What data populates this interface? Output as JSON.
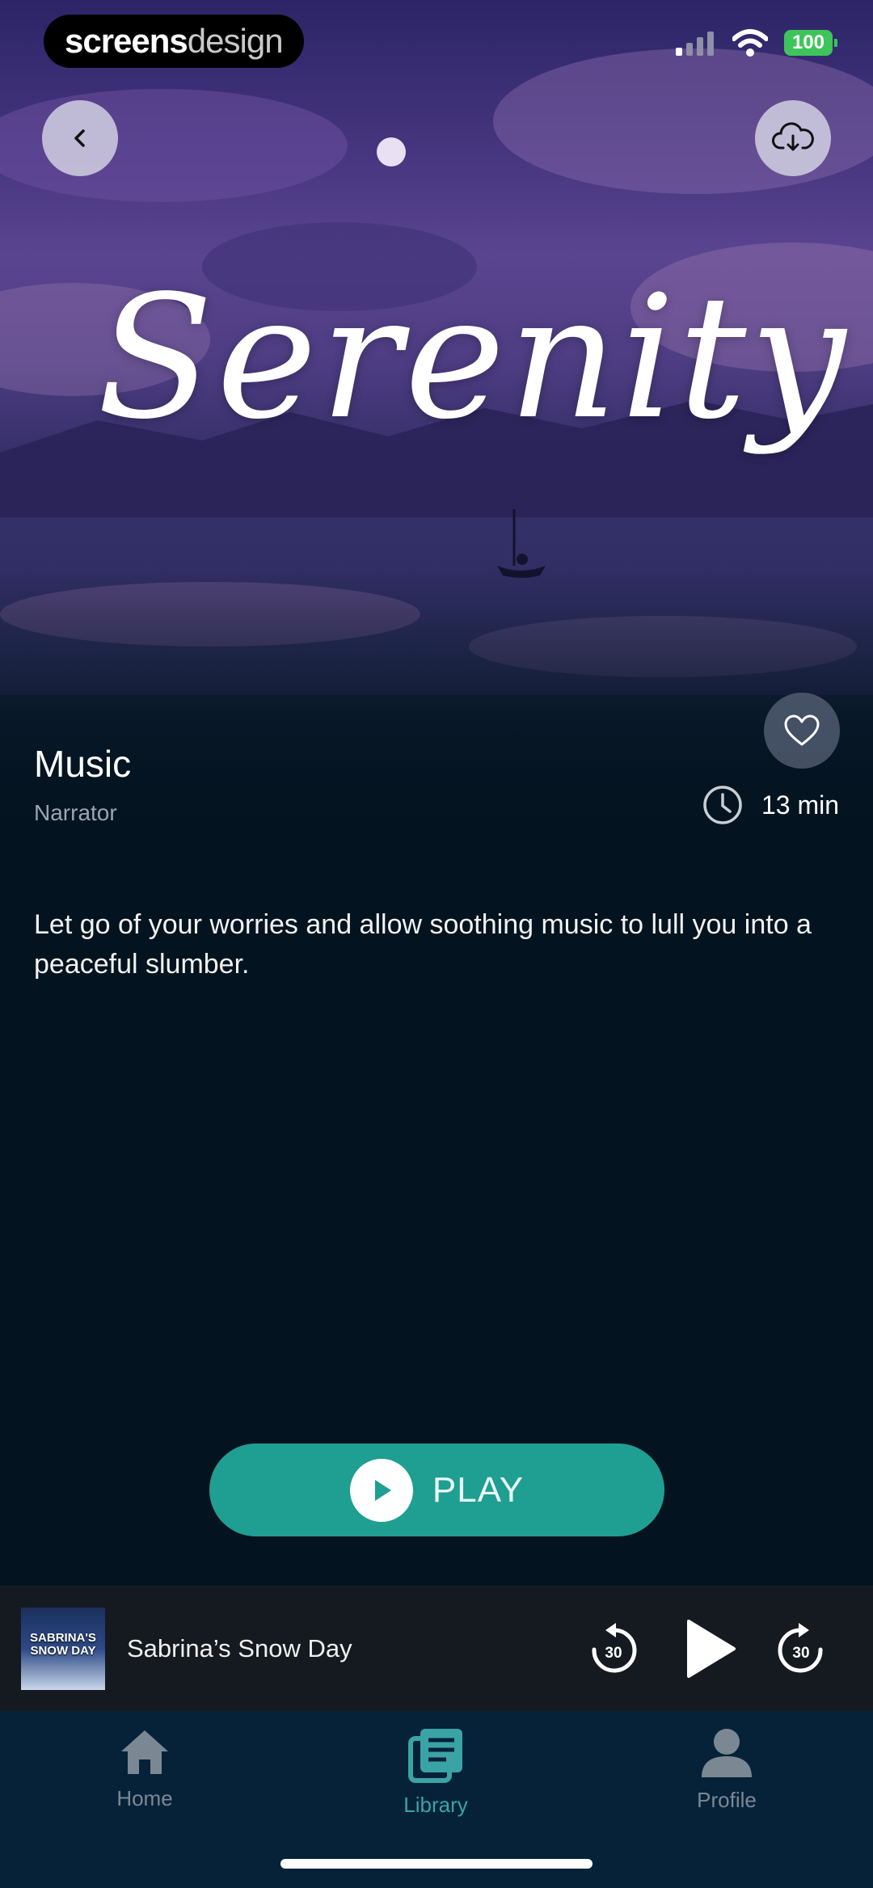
{
  "brand": {
    "part1": "screens",
    "part2": "design"
  },
  "status_bar": {
    "battery": "100"
  },
  "hero": {
    "title": "Serenity"
  },
  "item": {
    "title": "Music",
    "subtitle": "Narrator",
    "duration": "13 min"
  },
  "description": "Let go of your worries and allow soothing music to lull you into a peaceful slumber.",
  "play_button": {
    "label": "PLAY"
  },
  "mini_player": {
    "title": "Sabrina’s Snow Day",
    "art_text": "SABRINA'S SNOW DAY",
    "rewind_seconds": "30",
    "forward_seconds": "30"
  },
  "tabs": [
    {
      "label": "Home",
      "icon": "home-icon",
      "active": false
    },
    {
      "label": "Library",
      "icon": "library-icon",
      "active": true
    },
    {
      "label": "Profile",
      "icon": "profile-icon",
      "active": false
    }
  ],
  "colors": {
    "accent": "#1f9e92",
    "active_tab": "#3aa3a6",
    "inactive_tab": "#7b8894",
    "background": "#03131f"
  }
}
